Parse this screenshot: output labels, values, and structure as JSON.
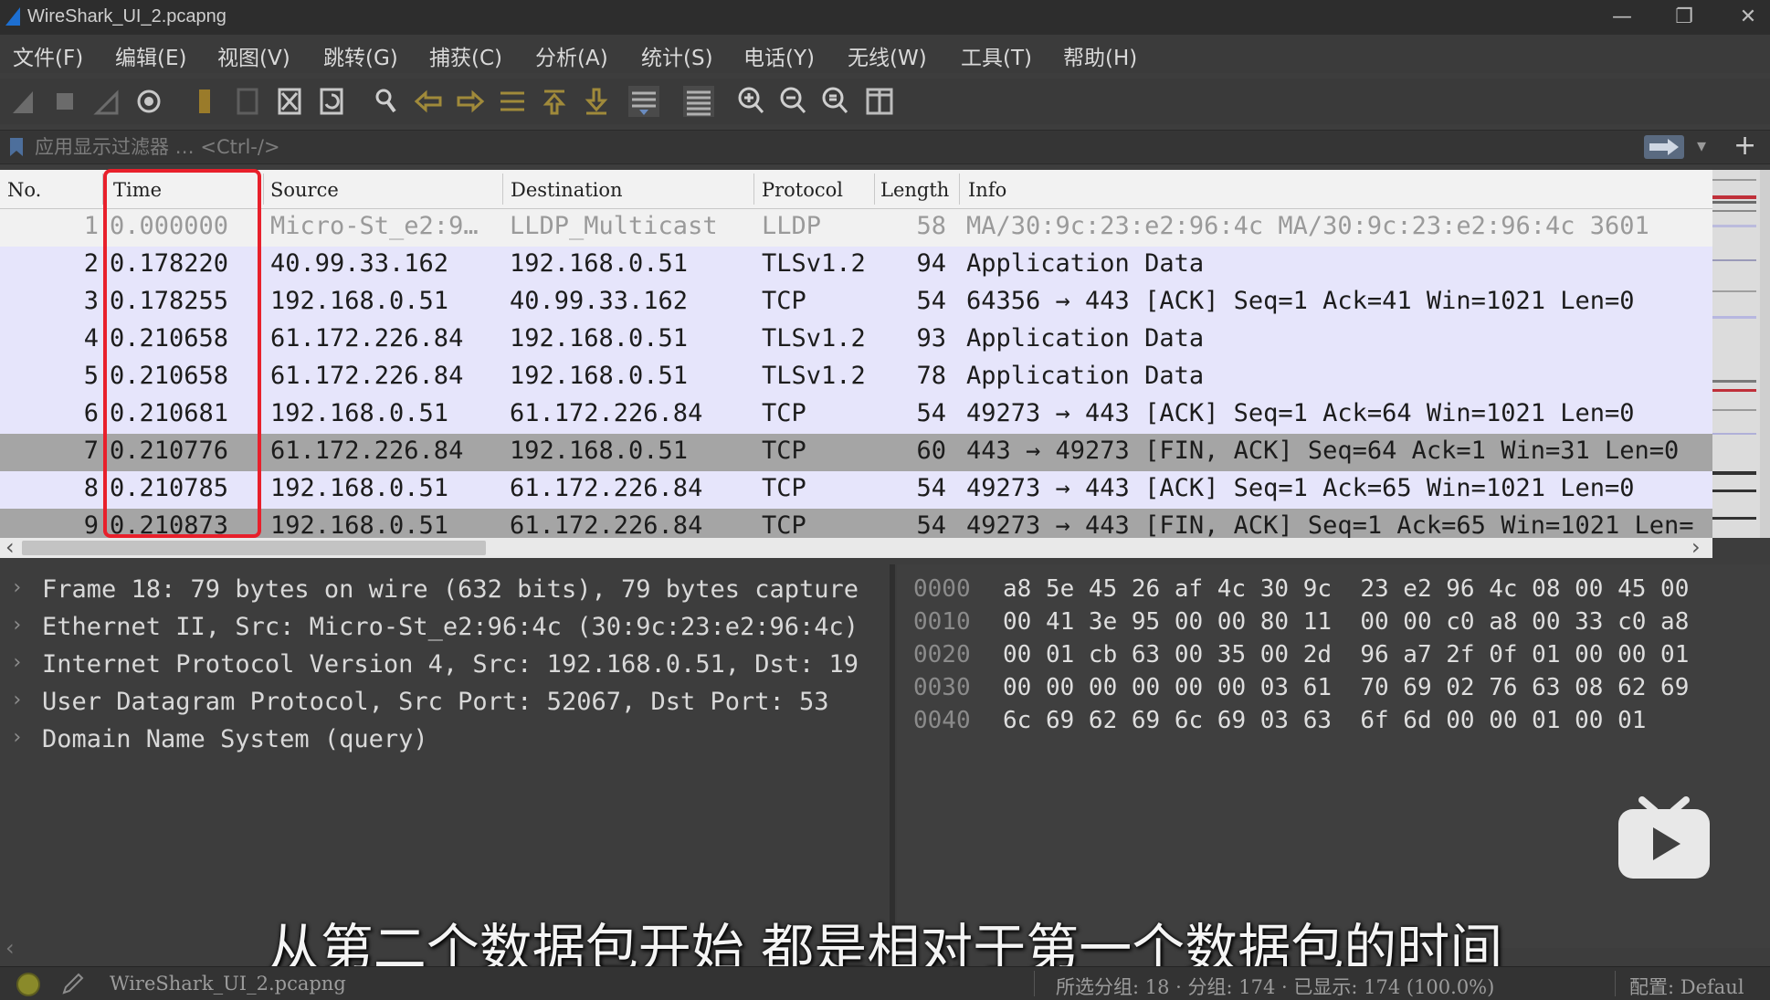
{
  "window": {
    "title": "WireShark_UI_2.pcapng",
    "minimize": "—",
    "restore": "❐",
    "close": "✕"
  },
  "menu": [
    "文件(F)",
    "编辑(E)",
    "视图(V)",
    "跳转(G)",
    "捕获(C)",
    "分析(A)",
    "统计(S)",
    "电话(Y)",
    "无线(W)",
    "工具(T)",
    "帮助(H)"
  ],
  "filter": {
    "placeholder": "应用显示过滤器 … <Ctrl-/>",
    "add": "+",
    "dropdown": "▾"
  },
  "packet_list": {
    "columns": [
      "No.",
      "Time",
      "Source",
      "Destination",
      "Protocol",
      "Length",
      "Info"
    ],
    "rows": [
      {
        "no": "1",
        "time": "0.000000",
        "source": "Micro-St_e2:9…",
        "destination": "LLDP_Multicast",
        "protocol": "LLDP",
        "length": "58",
        "info": "MA/30:9c:23:e2:96:4c MA/30:9c:23:e2:96:4c 3601",
        "style": "lldp"
      },
      {
        "no": "2",
        "time": "0.178220",
        "source": "40.99.33.162",
        "destination": "192.168.0.51",
        "protocol": "TLSv1.2",
        "length": "94",
        "info": "Application Data",
        "style": "tcp"
      },
      {
        "no": "3",
        "time": "0.178255",
        "source": "192.168.0.51",
        "destination": "40.99.33.162",
        "protocol": "TCP",
        "length": "54",
        "info": "64356 → 443 [ACK] Seq=1 Ack=41 Win=1021 Len=0",
        "style": "tcp"
      },
      {
        "no": "4",
        "time": "0.210658",
        "source": "61.172.226.84",
        "destination": "192.168.0.51",
        "protocol": "TLSv1.2",
        "length": "93",
        "info": "Application Data",
        "style": "tcp"
      },
      {
        "no": "5",
        "time": "0.210658",
        "source": "61.172.226.84",
        "destination": "192.168.0.51",
        "protocol": "TLSv1.2",
        "length": "78",
        "info": "Application Data",
        "style": "tcp"
      },
      {
        "no": "6",
        "time": "0.210681",
        "source": "192.168.0.51",
        "destination": "61.172.226.84",
        "protocol": "TCP",
        "length": "54",
        "info": "49273 → 443 [ACK] Seq=1 Ack=64 Win=1021 Len=0",
        "style": "tcp"
      },
      {
        "no": "7",
        "time": "0.210776",
        "source": "61.172.226.84",
        "destination": "192.168.0.51",
        "protocol": "TCP",
        "length": "60",
        "info": "443 → 49273 [FIN, ACK] Seq=64 Ack=1 Win=31 Len=0",
        "style": "fin"
      },
      {
        "no": "8",
        "time": "0.210785",
        "source": "192.168.0.51",
        "destination": "61.172.226.84",
        "protocol": "TCP",
        "length": "54",
        "info": "49273 → 443 [ACK] Seq=1 Ack=65 Win=1021 Len=0",
        "style": "tcp"
      },
      {
        "no": "9",
        "time": "0.210873",
        "source": "192.168.0.51",
        "destination": "61.172.226.84",
        "protocol": "TCP",
        "length": "54",
        "info": "49273 → 443 [FIN, ACK] Seq=1 Ack=65 Win=1021 Len=",
        "style": "fin"
      }
    ]
  },
  "details": [
    "Frame 18: 79 bytes on wire (632 bits), 79 bytes capture",
    "Ethernet II, Src: Micro-St_e2:96:4c (30:9c:23:e2:96:4c)",
    "Internet Protocol Version 4, Src: 192.168.0.51, Dst: 19",
    "User Datagram Protocol, Src Port: 52067, Dst Port: 53",
    "Domain Name System (query)"
  ],
  "bytes": [
    {
      "offset": "0000",
      "hex": "a8 5e 45 26 af 4c 30 9c  23 e2 96 4c 08 00 45 00"
    },
    {
      "offset": "0010",
      "hex": "00 41 3e 95 00 00 80 11  00 00 c0 a8 00 33 c0 a8"
    },
    {
      "offset": "0020",
      "hex": "00 01 cb 63 00 35 00 2d  96 a7 2f 0f 01 00 00 01"
    },
    {
      "offset": "0030",
      "hex": "00 00 00 00 00 00 03 61  70 69 02 76 63 08 62 69"
    },
    {
      "offset": "0040",
      "hex": "6c 69 62 69 6c 69 03 63  6f 6d 00 00 01 00 01"
    }
  ],
  "subtitle": "从第二个数据包开始 都是相对于第一个数据包的时间",
  "status": {
    "file": "WireShark_UI_2.pcapng",
    "stats": "所选分组: 18 · 分组: 174 · 已显示: 174 (100.0%)",
    "profile": "配置: Defaul"
  },
  "colors": {
    "row_tcp": "#e6e5fb",
    "row_lldp": "#f1f1f1",
    "row_fin": "#a5a5a5",
    "highlight_box": "#e8202b"
  }
}
